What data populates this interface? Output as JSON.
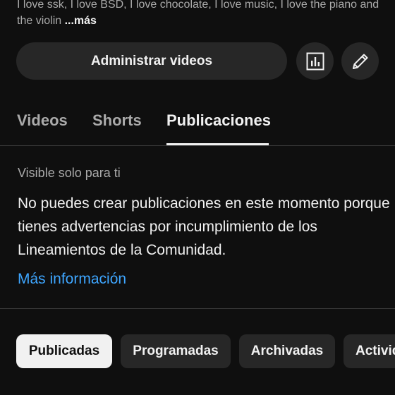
{
  "bio": {
    "text": "I love ssk, I love BSD, I love chocolate, I love music, I love the piano and the violin ",
    "more_label": "...más"
  },
  "actions": {
    "manage_videos_label": "Administrar videos",
    "analytics_icon": "bar-chart-icon",
    "edit_icon": "pencil-icon"
  },
  "tabs": [
    {
      "label": "Videos",
      "active": false
    },
    {
      "label": "Shorts",
      "active": false
    },
    {
      "label": "Publicaciones",
      "active": true
    }
  ],
  "notice": {
    "visibility": "Visible solo para ti",
    "message": "No puedes crear publicaciones en este momento porque tienes advertencias por incumplimiento de los Lineamientos de la Comunidad.",
    "link_label": "Más información"
  },
  "filter_chips": [
    {
      "label": "Publicadas",
      "selected": true
    },
    {
      "label": "Programadas",
      "selected": false
    },
    {
      "label": "Archivadas",
      "selected": false
    },
    {
      "label": "Activid",
      "selected": false
    }
  ],
  "colors": {
    "background": "#0f0f0f",
    "surface": "#272727",
    "text": "#f1f1f1",
    "muted": "#aaaaaa",
    "link": "#3ea6ff"
  }
}
